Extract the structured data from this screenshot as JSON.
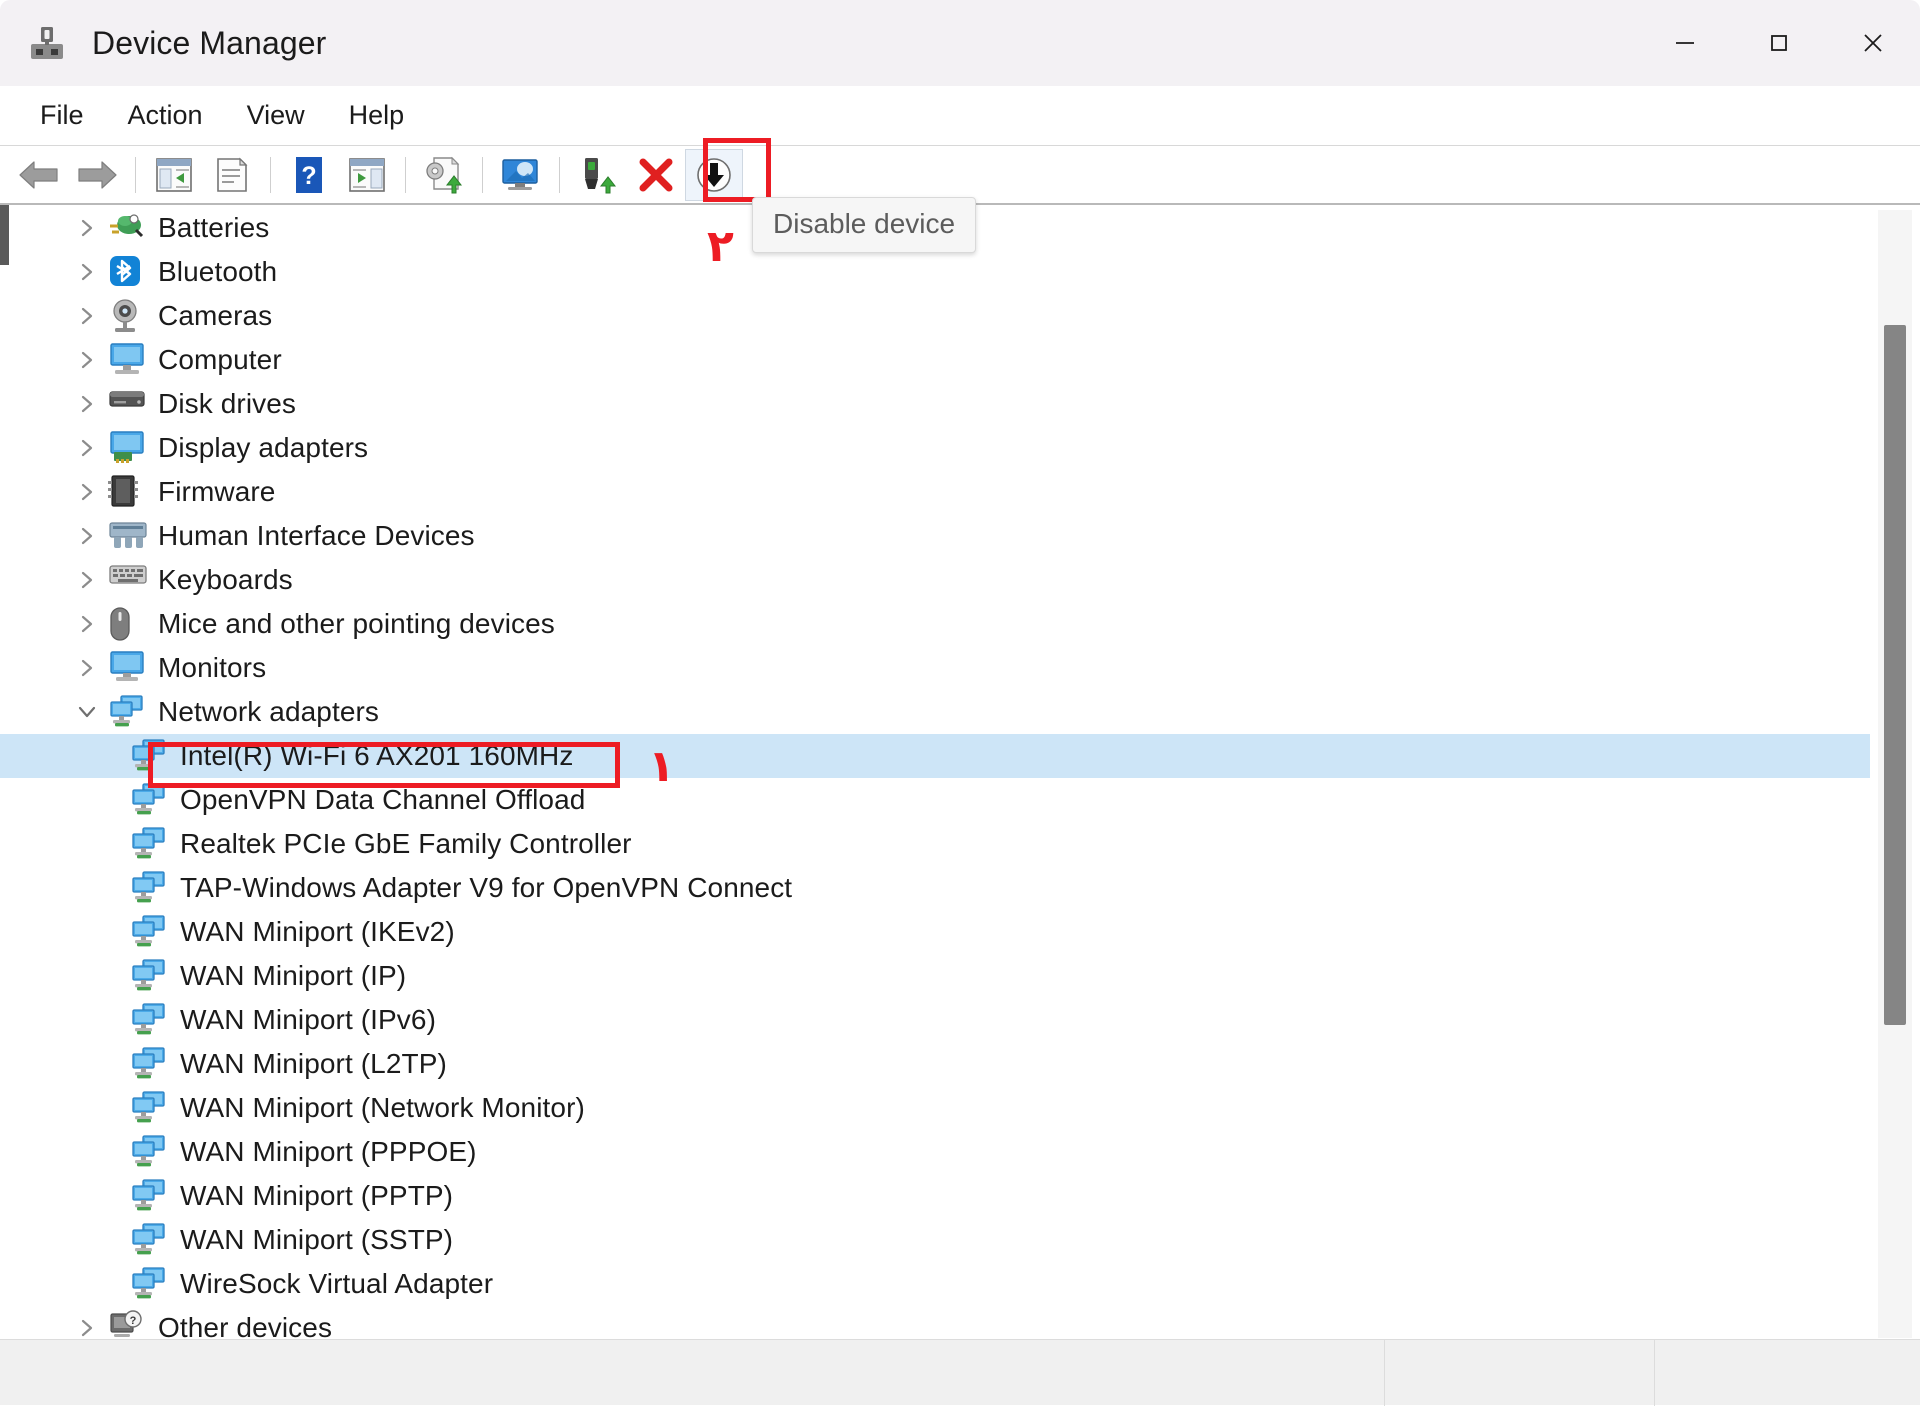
{
  "window": {
    "title": "Device Manager",
    "icon": "device-manager-icon",
    "controls": [
      {
        "name": "minimize-button",
        "glyph": "minimize-icon"
      },
      {
        "name": "maximize-button",
        "glyph": "maximize-icon"
      },
      {
        "name": "close-button",
        "glyph": "close-icon"
      }
    ]
  },
  "menubar": {
    "items": [
      {
        "label": "File"
      },
      {
        "label": "Action"
      },
      {
        "label": "View"
      },
      {
        "label": "Help"
      }
    ]
  },
  "toolbar": {
    "buttons": [
      {
        "name": "back-button",
        "icon": "back-arrow-icon",
        "title": "Back"
      },
      {
        "name": "forward-button",
        "icon": "forward-arrow-icon",
        "title": "Forward"
      },
      {
        "name": "show-hide-console-tree-button",
        "icon": "console-tree-icon",
        "title": "Show/Hide Console Tree"
      },
      {
        "name": "properties-button",
        "icon": "properties-page-icon",
        "title": "Properties"
      },
      {
        "name": "help-button",
        "icon": "help-question-icon",
        "title": "Help"
      },
      {
        "name": "show-hide-action-pane-button",
        "icon": "action-pane-icon",
        "title": "Show/Hide Action Pane"
      },
      {
        "name": "update-driver-button",
        "icon": "update-driver-icon",
        "title": "Update driver"
      },
      {
        "name": "scan-hardware-changes-button",
        "icon": "scan-monitor-icon",
        "title": "Scan for hardware changes"
      },
      {
        "name": "add-legacy-hardware-button",
        "icon": "add-hardware-icon",
        "title": "Add drivers"
      },
      {
        "name": "uninstall-device-button",
        "icon": "red-x-icon",
        "title": "Uninstall device"
      },
      {
        "name": "disable-device-button",
        "icon": "disable-down-arrow-icon",
        "title": "Disable device"
      }
    ],
    "tooltip": "Disable device"
  },
  "annotations": [
    {
      "name": "annotation-marker-1",
      "label": "١",
      "color": "#ed1c24",
      "target": "Intel(R) Wi-Fi 6 AX201 160MHz"
    },
    {
      "name": "annotation-marker-2",
      "label": "٢",
      "color": "#ed1c24",
      "target": "Disable device"
    }
  ],
  "highlights": {
    "selected_device_box_color": "#ed1c24",
    "disable_button_box_color": "#ed1c24",
    "selection_background": "#cde5f7"
  },
  "tree": {
    "items": [
      {
        "label": "Batteries",
        "level": 0,
        "expandable": true,
        "expanded": false,
        "icon": "battery-icon",
        "selected": false
      },
      {
        "label": "Bluetooth",
        "level": 0,
        "expandable": true,
        "expanded": false,
        "icon": "bluetooth-icon",
        "selected": false
      },
      {
        "label": "Cameras",
        "level": 0,
        "expandable": true,
        "expanded": false,
        "icon": "camera-icon",
        "selected": false
      },
      {
        "label": "Computer",
        "level": 0,
        "expandable": true,
        "expanded": false,
        "icon": "computer-icon",
        "selected": false
      },
      {
        "label": "Disk drives",
        "level": 0,
        "expandable": true,
        "expanded": false,
        "icon": "disk-drive-icon",
        "selected": false
      },
      {
        "label": "Display adapters",
        "level": 0,
        "expandable": true,
        "expanded": false,
        "icon": "display-adapter-icon",
        "selected": false
      },
      {
        "label": "Firmware",
        "level": 0,
        "expandable": true,
        "expanded": false,
        "icon": "firmware-icon",
        "selected": false
      },
      {
        "label": "Human Interface Devices",
        "level": 0,
        "expandable": true,
        "expanded": false,
        "icon": "hid-icon",
        "selected": false
      },
      {
        "label": "Keyboards",
        "level": 0,
        "expandable": true,
        "expanded": false,
        "icon": "keyboard-icon",
        "selected": false
      },
      {
        "label": "Mice and other pointing devices",
        "level": 0,
        "expandable": true,
        "expanded": false,
        "icon": "mouse-icon",
        "selected": false
      },
      {
        "label": "Monitors",
        "level": 0,
        "expandable": true,
        "expanded": false,
        "icon": "monitor-icon",
        "selected": false
      },
      {
        "label": "Network adapters",
        "level": 0,
        "expandable": true,
        "expanded": true,
        "icon": "network-adapter-icon",
        "selected": false
      },
      {
        "label": "Intel(R) Wi-Fi 6 AX201 160MHz",
        "level": 1,
        "expandable": false,
        "expanded": false,
        "icon": "network-device-icon",
        "selected": true
      },
      {
        "label": "OpenVPN Data Channel Offload",
        "level": 1,
        "expandable": false,
        "expanded": false,
        "icon": "network-device-icon",
        "selected": false
      },
      {
        "label": "Realtek PCIe GbE Family Controller",
        "level": 1,
        "expandable": false,
        "expanded": false,
        "icon": "network-device-icon",
        "selected": false
      },
      {
        "label": "TAP-Windows Adapter V9 for OpenVPN Connect",
        "level": 1,
        "expandable": false,
        "expanded": false,
        "icon": "network-device-icon",
        "selected": false
      },
      {
        "label": "WAN Miniport (IKEv2)",
        "level": 1,
        "expandable": false,
        "expanded": false,
        "icon": "network-device-icon",
        "selected": false
      },
      {
        "label": "WAN Miniport (IP)",
        "level": 1,
        "expandable": false,
        "expanded": false,
        "icon": "network-device-icon",
        "selected": false
      },
      {
        "label": "WAN Miniport (IPv6)",
        "level": 1,
        "expandable": false,
        "expanded": false,
        "icon": "network-device-icon",
        "selected": false
      },
      {
        "label": "WAN Miniport (L2TP)",
        "level": 1,
        "expandable": false,
        "expanded": false,
        "icon": "network-device-icon",
        "selected": false
      },
      {
        "label": "WAN Miniport (Network Monitor)",
        "level": 1,
        "expandable": false,
        "expanded": false,
        "icon": "network-device-icon",
        "selected": false
      },
      {
        "label": "WAN Miniport (PPPOE)",
        "level": 1,
        "expandable": false,
        "expanded": false,
        "icon": "network-device-icon",
        "selected": false
      },
      {
        "label": "WAN Miniport (PPTP)",
        "level": 1,
        "expandable": false,
        "expanded": false,
        "icon": "network-device-icon",
        "selected": false
      },
      {
        "label": "WAN Miniport (SSTP)",
        "level": 1,
        "expandable": false,
        "expanded": false,
        "icon": "network-device-icon",
        "selected": false
      },
      {
        "label": "WireSock Virtual Adapter",
        "level": 1,
        "expandable": false,
        "expanded": false,
        "icon": "network-device-icon",
        "selected": false
      },
      {
        "label": "Other devices",
        "level": 0,
        "expandable": true,
        "expanded": false,
        "icon": "unknown-device-icon",
        "selected": false
      }
    ]
  },
  "statusbar": {
    "main_text": "",
    "pane_2": "",
    "pane_3": ""
  }
}
